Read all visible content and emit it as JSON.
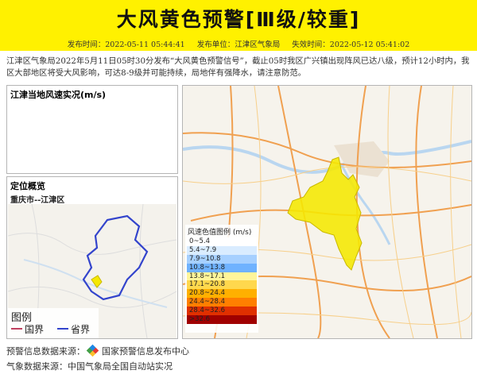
{
  "header": {
    "title": "大风黄色预警[Ⅲ级/较重]",
    "publish_time_label": "发布时间：2022-05-11 05:44:41",
    "publisher_label": "发布单位：江津区气象局",
    "expire_label": "失效时间：2022-05-12 05:41:02"
  },
  "description": "江津区气象局2022年5月11日05时30分发布“大风黄色预警信号”，截止05时我区广兴镇出现阵风已达八级，预计12小时内，我区大部地区将受大风影响，可达8-9级并可能持续，局地伴有强降水，请注意防范。",
  "wind_panel": {
    "title": "江津当地风速实况(m/s)"
  },
  "location_panel": {
    "title": "定位概览",
    "subtitle": "重庆市--江津区"
  },
  "mini_legend": {
    "title": "图例",
    "items": [
      "国界",
      "省界"
    ]
  },
  "legend": {
    "title": "风速色值图例 (m/s)",
    "items": [
      {
        "label": "0~5.4",
        "color": "#ffffff"
      },
      {
        "label": "5.4~7.9",
        "color": "#d9ecff"
      },
      {
        "label": "7.9~10.8",
        "color": "#a6d0ff"
      },
      {
        "label": "10.8~13.8",
        "color": "#6fb2ff"
      },
      {
        "label": "13.8~17.1",
        "color": "#fff59a"
      },
      {
        "label": "17.1~20.8",
        "color": "#ffd84d"
      },
      {
        "label": "20.8~24.4",
        "color": "#ffb000"
      },
      {
        "label": "24.4~28.4",
        "color": "#ff7f00"
      },
      {
        "label": "28.4~32.6",
        "color": "#e03000"
      },
      {
        "label": ">32.6",
        "color": "#a00000"
      }
    ]
  },
  "footer": {
    "source_label": "预警信息数据来源：",
    "source_name": "国家预警信息发布中心",
    "weather_source": "气象数据来源：中国气象局全国自动站实况"
  },
  "colors": {
    "banner": "#fff100",
    "warning_area": "#f5e800",
    "border_line": "#3344cc"
  }
}
